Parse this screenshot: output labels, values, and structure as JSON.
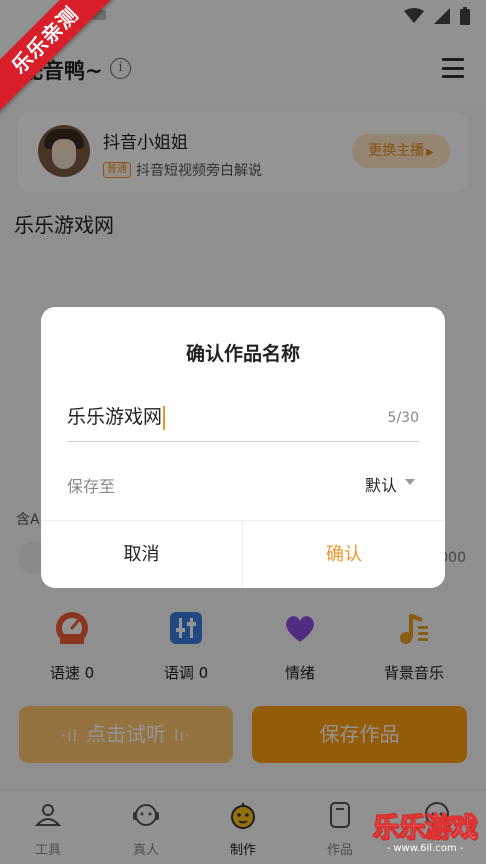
{
  "status_bar": {
    "icons": [
      "wifi-icon",
      "signal-icon",
      "battery-icon"
    ]
  },
  "ribbon": {
    "text": "乐乐亲测"
  },
  "header": {
    "title": "配音鸭~",
    "info_icon": "ⓘ"
  },
  "anchor": {
    "name": "抖音小姐姐",
    "badge": "普通",
    "description": "抖音短视频旁白解说",
    "switch_label": "更换主播",
    "switch_arrow": "▶"
  },
  "editor": {
    "text": "乐乐游戏网"
  },
  "section": {
    "label": "含A",
    "right_value": "000"
  },
  "tools": [
    {
      "label": "语速 0",
      "icon": "speedometer-icon",
      "color": "#f05a3c"
    },
    {
      "label": "语调 0",
      "icon": "equalizer-icon",
      "color": "#3a7de0"
    },
    {
      "label": "情绪",
      "icon": "heart-icon",
      "color": "#8a4fe0"
    },
    {
      "label": "背景音乐",
      "icon": "music-note-icon",
      "color": "#f0a020"
    }
  ],
  "actions": {
    "listen": "点击试听",
    "listen_wave_left": "·ıl",
    "listen_wave_right": "lı·",
    "save": "保存作品"
  },
  "nav": [
    {
      "label": "工具",
      "icon": "person-icon"
    },
    {
      "label": "真人",
      "icon": "headset-icon"
    },
    {
      "label": "制作",
      "icon": "duck-icon"
    },
    {
      "label": "作品",
      "icon": "document-icon"
    },
    {
      "label": "",
      "icon": "chat-icon"
    }
  ],
  "dialog": {
    "title": "确认作品名称",
    "name_value": "乐乐游戏网",
    "char_count": "5/30",
    "save_to_label": "保存至",
    "save_to_value": "默认",
    "cancel": "取消",
    "confirm": "确认"
  },
  "watermark": {
    "big": "乐乐游戏",
    "small": "- www.6ll.com -"
  },
  "colors": {
    "accent": "#f0962a",
    "save_button": "#ff9d0e",
    "listen_button": "#ffc76e",
    "ribbon": "#d9202a"
  }
}
